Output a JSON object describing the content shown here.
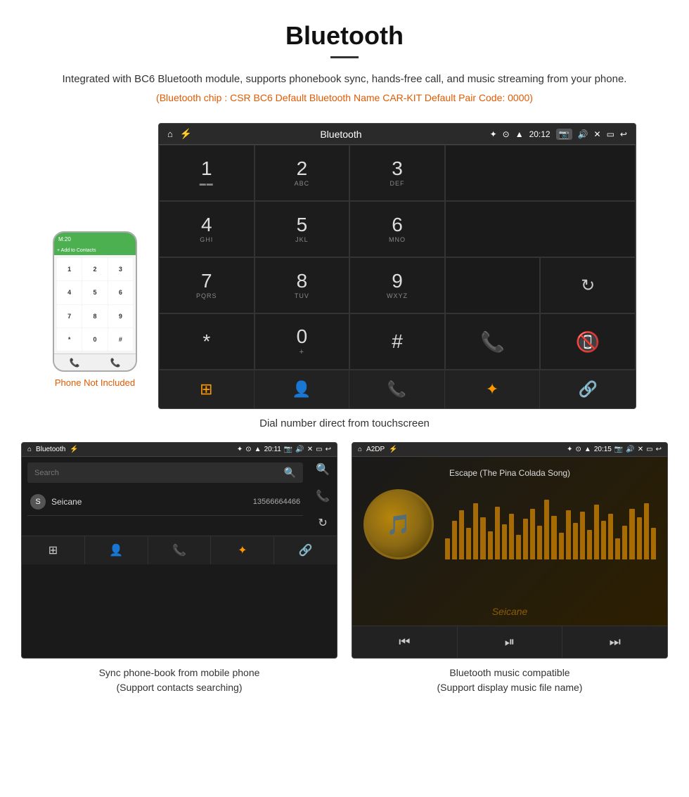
{
  "page": {
    "title": "Bluetooth",
    "description": "Integrated with BC6 Bluetooth module, supports phonebook sync, hands-free call, and music streaming from your phone.",
    "specs_line": "(Bluetooth chip : CSR BC6    Default Bluetooth Name CAR-KIT    Default Pair Code: 0000)"
  },
  "main_screen": {
    "status_bar": {
      "app_name": "Bluetooth",
      "time": "20:12"
    },
    "dial_keys": [
      {
        "num": "1",
        "sub": "▬▬"
      },
      {
        "num": "2",
        "sub": "ABC"
      },
      {
        "num": "3",
        "sub": "DEF"
      },
      {
        "num": "",
        "sub": ""
      },
      {
        "num": "⌫",
        "sub": ""
      },
      {
        "num": "4",
        "sub": "GHI"
      },
      {
        "num": "5",
        "sub": "JKL"
      },
      {
        "num": "6",
        "sub": "MNO"
      },
      {
        "num": "",
        "sub": ""
      },
      {
        "num": "",
        "sub": ""
      },
      {
        "num": "7",
        "sub": "PQRS"
      },
      {
        "num": "8",
        "sub": "TUV"
      },
      {
        "num": "9",
        "sub": "WXYZ"
      },
      {
        "num": "",
        "sub": ""
      },
      {
        "num": "↻",
        "sub": ""
      },
      {
        "num": "*",
        "sub": ""
      },
      {
        "num": "0",
        "sub": "+"
      },
      {
        "num": "#",
        "sub": ""
      },
      {
        "num": "✆",
        "sub": "green"
      },
      {
        "num": "✆",
        "sub": "red"
      }
    ],
    "fn_bar": [
      "⊞",
      "👤",
      "📞",
      "✦",
      "🔗"
    ]
  },
  "main_caption": "Dial number direct from touchscreen",
  "phone_aside": {
    "not_included": "Phone Not Included"
  },
  "bottom_left": {
    "status_bar": {
      "app_name": "Bluetooth",
      "time": "20:11"
    },
    "search_placeholder": "Search",
    "contact": {
      "initial": "S",
      "name": "Seicane",
      "number": "13566664466"
    },
    "caption_line1": "Sync phone-book from mobile phone",
    "caption_line2": "(Support contacts searching)"
  },
  "bottom_right": {
    "status_bar": {
      "app_name": "A2DP",
      "time": "20:15"
    },
    "song_title": "Escape (The Pina Colada Song)",
    "caption_line1": "Bluetooth music compatible",
    "caption_line2": "(Support display music file name)",
    "watermark": "Seicane"
  },
  "eq_bars": [
    30,
    55,
    70,
    45,
    80,
    60,
    40,
    75,
    50,
    65,
    35,
    58,
    72,
    48,
    85,
    62,
    38,
    70,
    52,
    68,
    42,
    78,
    55,
    65,
    30,
    48,
    72,
    60,
    80,
    45
  ]
}
